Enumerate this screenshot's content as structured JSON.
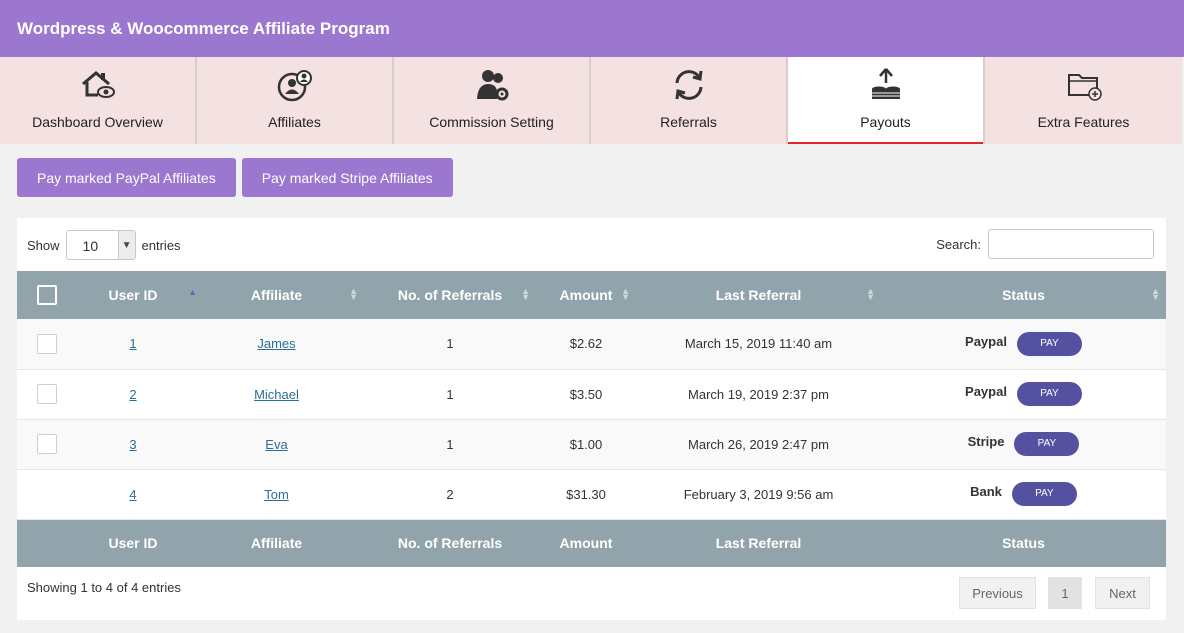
{
  "app": {
    "title": "Wordpress & Woocommerce Affiliate Program"
  },
  "tabs": [
    {
      "label": "Dashboard Overview",
      "icon": "home-eye-icon"
    },
    {
      "label": "Affiliates",
      "icon": "users-circle-icon"
    },
    {
      "label": "Commission Setting",
      "icon": "users-gear-icon"
    },
    {
      "label": "Referrals",
      "icon": "refresh-icon"
    },
    {
      "label": "Payouts",
      "icon": "coins-upload-icon",
      "active": true
    },
    {
      "label": "Extra Features",
      "icon": "folder-plus-icon"
    }
  ],
  "actions": {
    "paypal_label": "Pay marked PayPal Affiliates",
    "stripe_label": "Pay marked Stripe Affiliates"
  },
  "controls": {
    "show_label": "Show",
    "entries_value": "10",
    "entries_label": "entries",
    "search_label": "Search:"
  },
  "table": {
    "headers": [
      "User ID",
      "Affiliate",
      "No. of Referrals",
      "Amount",
      "Last Referral",
      "Status"
    ],
    "rows": [
      {
        "id": "1",
        "affiliate": "James",
        "referrals": "1",
        "amount": "$2.62",
        "last": "March 15, 2019 11:40 am",
        "status": "Paypal",
        "action": "PAY",
        "checkbox": true
      },
      {
        "id": "2",
        "affiliate": "Michael",
        "referrals": "1",
        "amount": "$3.50",
        "last": "March 19, 2019 2:37 pm",
        "status": "Paypal",
        "action": "PAY",
        "checkbox": true
      },
      {
        "id": "3",
        "affiliate": "Eva",
        "referrals": "1",
        "amount": "$1.00",
        "last": "March 26, 2019 2:47 pm",
        "status": "Stripe",
        "action": "PAY",
        "checkbox": true
      },
      {
        "id": "4",
        "affiliate": "Tom",
        "referrals": "2",
        "amount": "$31.30",
        "last": "February 3, 2019 9:56 am",
        "status": "Bank",
        "action": "PAY",
        "checkbox": false
      }
    ]
  },
  "footer": {
    "info": "Showing 1 to 4 of 4 entries",
    "previous": "Previous",
    "page": "1",
    "next": "Next"
  },
  "colors": {
    "accent": "#9b77d0",
    "header": "#92a4ab",
    "pay": "#5451a0",
    "active_tab_underline": "#e0262f"
  }
}
